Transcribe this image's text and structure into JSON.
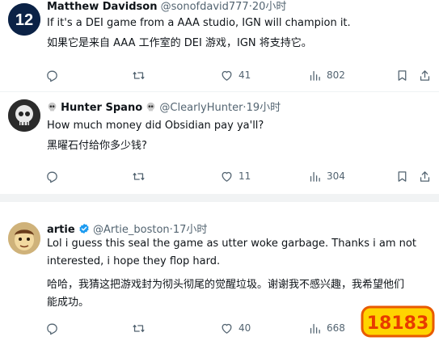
{
  "tweets": [
    {
      "name": "Matthew Davidson",
      "handle": "@sonofdavid777",
      "time": "20小时",
      "lines": [
        "If it's a DEI game from a AAA studio, IGN will champion it.",
        "如果它是来自 AAA 工作室的 DEI 游戏，IGN 将支持它。"
      ],
      "avatar_label": "12",
      "likes": "41",
      "views": "802"
    },
    {
      "name": "Hunter Spano",
      "handle": "@ClearlyHunter",
      "time": "19小时",
      "lines": [
        "How much money did Obsidian pay ya'll?",
        "黑曜石付给你多少钱?"
      ],
      "likes": "11",
      "views": "304"
    },
    {
      "name": "artie",
      "handle": "@Artie_boston",
      "time": "17小时",
      "lines": [
        "Lol i guess this seal the game as utter woke garbage. Thanks i am not",
        "interested, i hope they flop hard.",
        "哈哈，我猜这把游戏封为彻头彻尾的觉醒垃圾。谢谢我不感兴趣，我希望他们",
        "能成功。"
      ],
      "likes": "40",
      "views": "668"
    }
  ],
  "separator": "·",
  "watermark": "18183",
  "colors": {
    "text": "#0f1419",
    "muted": "#536471",
    "verified": "#1d9bf0",
    "divider": "#f1f3f4",
    "seahawks_navy": "#0b2246",
    "seahawks_green": "#69be28"
  },
  "icons": [
    "reply-icon",
    "retweet-icon",
    "like-icon",
    "views-icon",
    "bookmark-icon",
    "share-icon",
    "skull-emoji-icon",
    "verified-badge-icon"
  ]
}
